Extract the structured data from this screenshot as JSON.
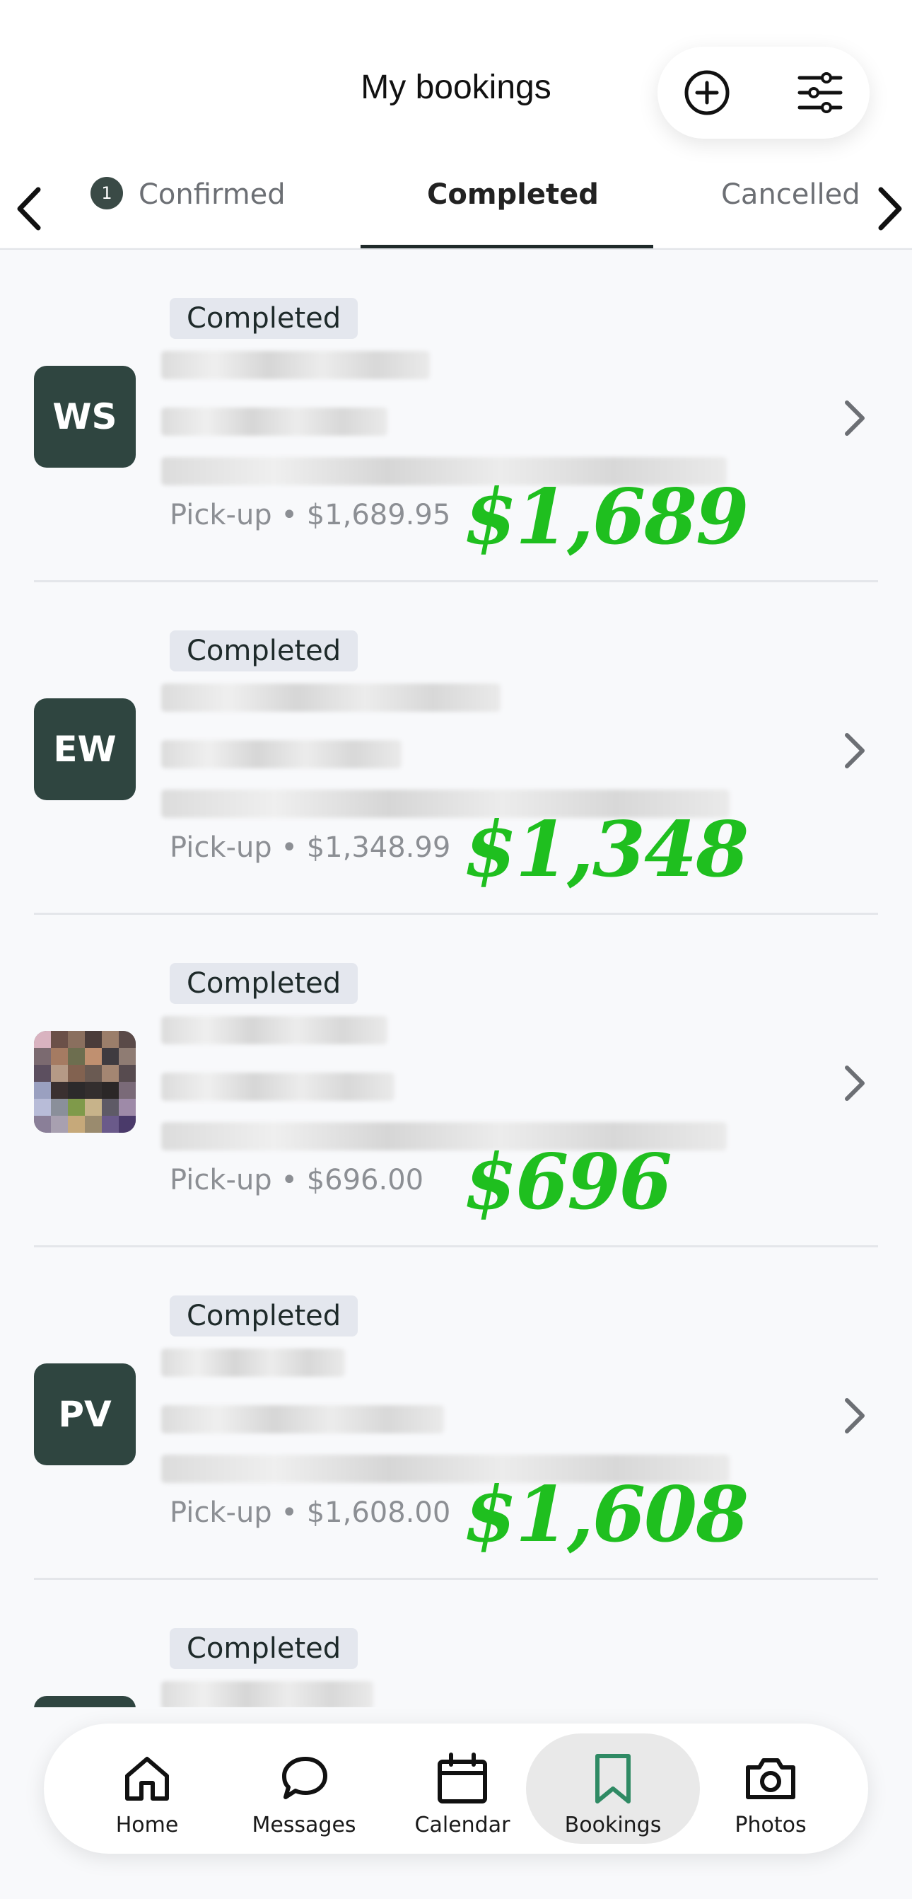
{
  "header": {
    "title": "My bookings",
    "add_icon": "plus-circle-icon",
    "filter_icon": "sliders-icon"
  },
  "tabs": {
    "items": [
      {
        "label": "Confirmed",
        "badge": "1"
      },
      {
        "label": "Completed",
        "active": true
      },
      {
        "label": "Cancelled"
      }
    ]
  },
  "bookings": [
    {
      "status": "Completed",
      "initials": "WS",
      "meta": "Pick-up • $1,689.95",
      "annotation": "$1,689"
    },
    {
      "status": "Completed",
      "initials": "EW",
      "meta": "Pick-up • $1,348.99",
      "annotation": "$1,348"
    },
    {
      "status": "Completed",
      "initials": "",
      "meta": "Pick-up • $696.00",
      "annotation": "$696"
    },
    {
      "status": "Completed",
      "initials": "PV",
      "meta": "Pick-up • $1,608.00",
      "annotation": "$1,608"
    },
    {
      "status": "Completed",
      "initials": "",
      "meta": "",
      "annotation": ""
    }
  ],
  "nav": {
    "items": [
      {
        "label": "Home",
        "icon": "home-icon"
      },
      {
        "label": "Messages",
        "icon": "chat-bubble-icon"
      },
      {
        "label": "Calendar",
        "icon": "calendar-icon"
      },
      {
        "label": "Bookings",
        "icon": "bookmark-icon",
        "active": true
      },
      {
        "label": "Photos",
        "icon": "camera-icon"
      }
    ]
  },
  "colors": {
    "avatar": "#2f4540",
    "annotation": "#1fbf1f",
    "active_nav_icon": "#2f8a64"
  }
}
